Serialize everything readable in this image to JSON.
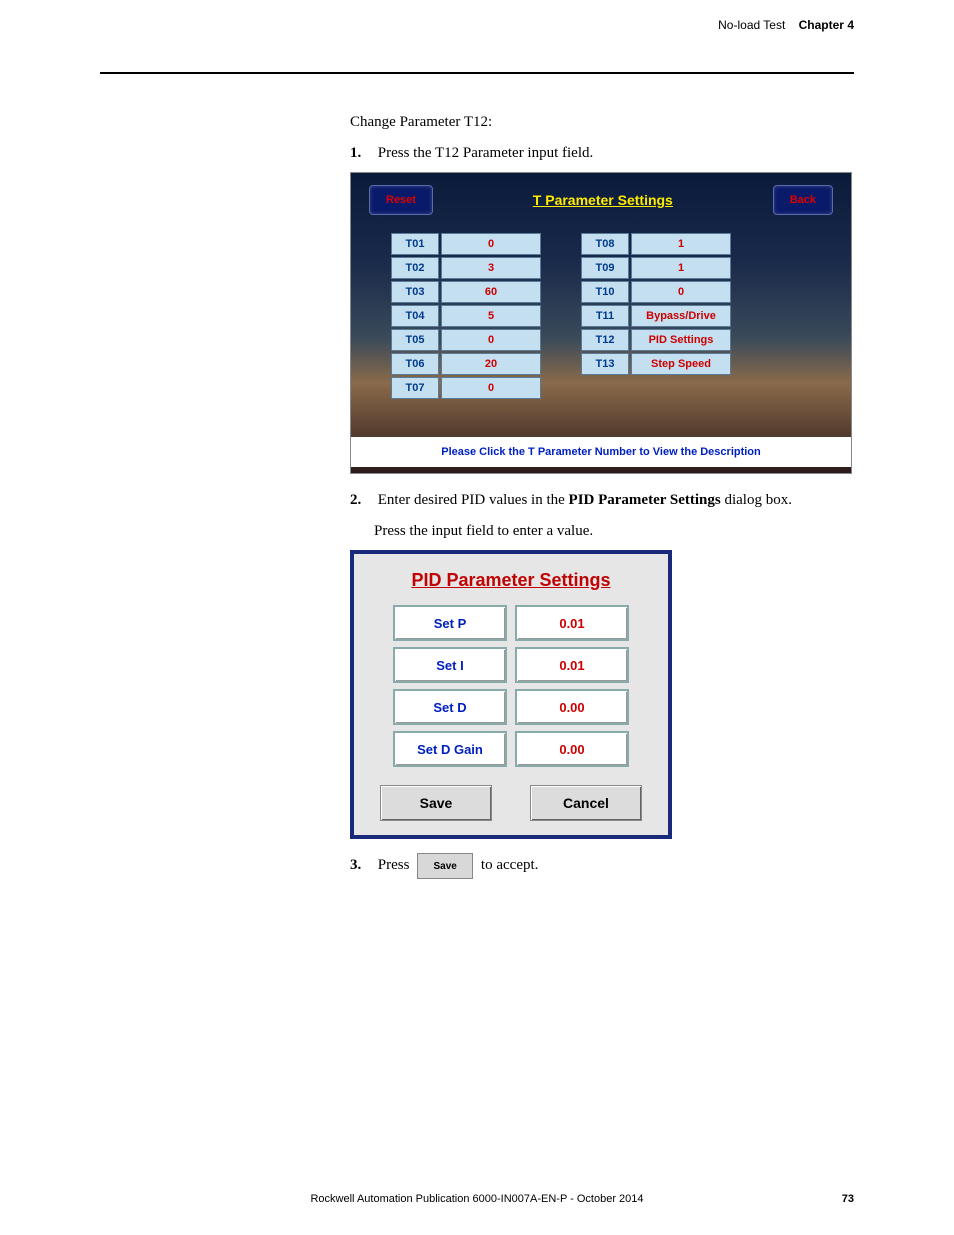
{
  "header": {
    "left": "No-load Test",
    "right": "Chapter 4"
  },
  "intro": "Change Parameter T12:",
  "steps": {
    "s1_num": "1.",
    "s1_text": "Press the T12 Parameter input field.",
    "s2_num": "2.",
    "s2_text_a": "Enter desired PID values in the ",
    "s2_text_b": "PID Parameter Settings",
    "s2_text_c": " dialog box.",
    "s2_sub": "Press the input field to enter a value.",
    "s3_num": "3.",
    "s3_text_a": "Press ",
    "s3_btn": "Save",
    "s3_text_b": " to accept."
  },
  "t_panel": {
    "reset": "Reset",
    "title": "T Parameter Settings",
    "back": "Back",
    "left_rows": [
      {
        "label": "T01",
        "value": "0"
      },
      {
        "label": "T02",
        "value": "3"
      },
      {
        "label": "T03",
        "value": "60"
      },
      {
        "label": "T04",
        "value": "5"
      },
      {
        "label": "T05",
        "value": "0"
      },
      {
        "label": "T06",
        "value": "20"
      },
      {
        "label": "T07",
        "value": "0"
      }
    ],
    "right_rows": [
      {
        "label": "T08",
        "value": "1"
      },
      {
        "label": "T09",
        "value": "1"
      },
      {
        "label": "T10",
        "value": "0"
      },
      {
        "label": "T11",
        "value": "Bypass/Drive"
      },
      {
        "label": "T12",
        "value": "PID Settings"
      },
      {
        "label": "T13",
        "value": "Step Speed"
      }
    ],
    "footer": "Please Click the T Parameter Number to View the Description"
  },
  "pid": {
    "title": "PID Parameter Settings",
    "rows": [
      {
        "label": "Set P",
        "value": "0.01"
      },
      {
        "label": "Set I",
        "value": "0.01"
      },
      {
        "label": "Set D",
        "value": "0.00"
      },
      {
        "label": "Set D Gain",
        "value": "0.00"
      }
    ],
    "save": "Save",
    "cancel": "Cancel"
  },
  "footer": {
    "center": "Rockwell Automation Publication 6000-IN007A-EN-P - October 2014",
    "page": "73"
  }
}
